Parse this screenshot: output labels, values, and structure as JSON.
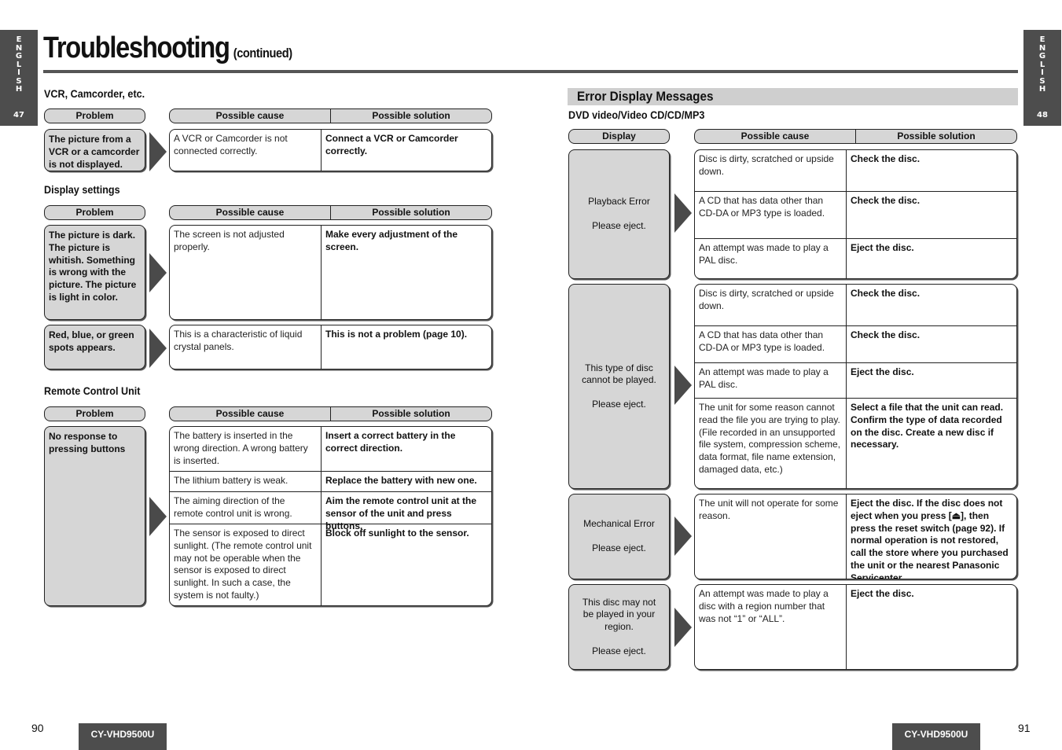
{
  "side_tabs": {
    "left": {
      "letters": "E\nN\nG\nL\nI\nS\nH",
      "page": "47"
    },
    "right": {
      "letters": "E\nN\nG\nL\nI\nS\nH",
      "page": "48"
    }
  },
  "page_title": {
    "main": "Troubleshooting",
    "sub": "(continued)"
  },
  "headers": {
    "problem": "Problem",
    "display": "Display",
    "cause": "Possible cause",
    "solution": "Possible solution"
  },
  "left_sections": [
    {
      "heading": "VCR, Camcorder, etc.",
      "rows": [
        {
          "problem": "The picture from a VCR or a camcorder is not displayed.",
          "items": [
            {
              "cause": "A VCR or Camcorder is not connected correctly.",
              "solution": "Connect a VCR or Camcorder correctly."
            }
          ]
        }
      ]
    },
    {
      "heading": "Display settings",
      "rows": [
        {
          "problem": "The picture is dark. The picture is whitish. Something is wrong with the picture. The picture is light in color.",
          "items": [
            {
              "cause": "The screen is not adjusted properly.",
              "solution": "Make every adjustment of the screen."
            }
          ]
        },
        {
          "problem": "Red, blue, or green spots appears.",
          "items": [
            {
              "cause": "This is a characteristic of liquid crystal panels.",
              "solution": "This is not a problem (page 10)."
            }
          ]
        }
      ]
    },
    {
      "heading": "Remote Control Unit",
      "rows": [
        {
          "problem": "No response to pressing buttons",
          "items": [
            {
              "cause": "The battery is inserted in the wrong direction. A wrong battery is inserted.",
              "solution": "Insert a correct battery in the correct direction."
            },
            {
              "cause": "The lithium battery is weak.",
              "solution": "Replace the battery with new one."
            },
            {
              "cause": "The aiming direction of the remote control unit is wrong.",
              "solution": "Aim the remote control unit at the sensor of the unit and press buttons."
            },
            {
              "cause": "The sensor is exposed to direct sunlight. (The remote control unit may not be operable when the sensor is exposed to direct sunlight. In such a case, the system is not faulty.)",
              "solution": "Block off sunlight to the sensor."
            }
          ]
        }
      ]
    }
  ],
  "error_section": {
    "title": "Error Display Messages",
    "subtitle": "DVD video/Video CD/CD/MP3",
    "rows": [
      {
        "display": "Playback Error\n\nPlease eject.",
        "items": [
          {
            "cause": "Disc is dirty, scratched or upside down.",
            "solution": "Check the disc."
          },
          {
            "cause": "A CD that has data other than CD-DA or MP3 type is loaded.",
            "solution": "Check the disc."
          },
          {
            "cause": "An attempt was made to play a PAL disc.",
            "solution": "Eject the disc."
          }
        ]
      },
      {
        "display": "This type of disc\ncannot be played.\n\nPlease eject.",
        "items": [
          {
            "cause": "Disc is dirty, scratched or upside down.",
            "solution": "Check the disc."
          },
          {
            "cause": "A CD that has data other than CD-DA or MP3 type is loaded.",
            "solution": "Check the disc."
          },
          {
            "cause": "An attempt was made to play a PAL disc.",
            "solution": "Eject the disc."
          },
          {
            "cause": "The unit for some reason cannot read the file you are trying to play. (File recorded in an unsupported file system, compression scheme, data format, file name extension, damaged data, etc.)",
            "solution": "Select a file that the unit can read. Confirm the type of data recorded on the disc. Create a new disc if necessary."
          }
        ]
      },
      {
        "display": "Mechanical Error\n\nPlease eject.",
        "items": [
          {
            "cause": "The unit will not operate for some reason.",
            "solution": "Eject the disc. If the disc does not eject when you press [⏏], then press the reset switch (page 92).  If normal operation is not restored, call the store where you purchased the unit or the nearest Panasonic Servicenter."
          }
        ]
      },
      {
        "display": "This disc may not\nbe played in your\nregion.\n\nPlease eject.",
        "items": [
          {
            "cause": "An attempt was made to play a disc with a region number that was not “1” or “ALL”.",
            "solution": "Eject the disc."
          }
        ]
      }
    ]
  },
  "footer": {
    "left_page": "90",
    "right_page": "91",
    "model": "CY-VHD9500U"
  }
}
